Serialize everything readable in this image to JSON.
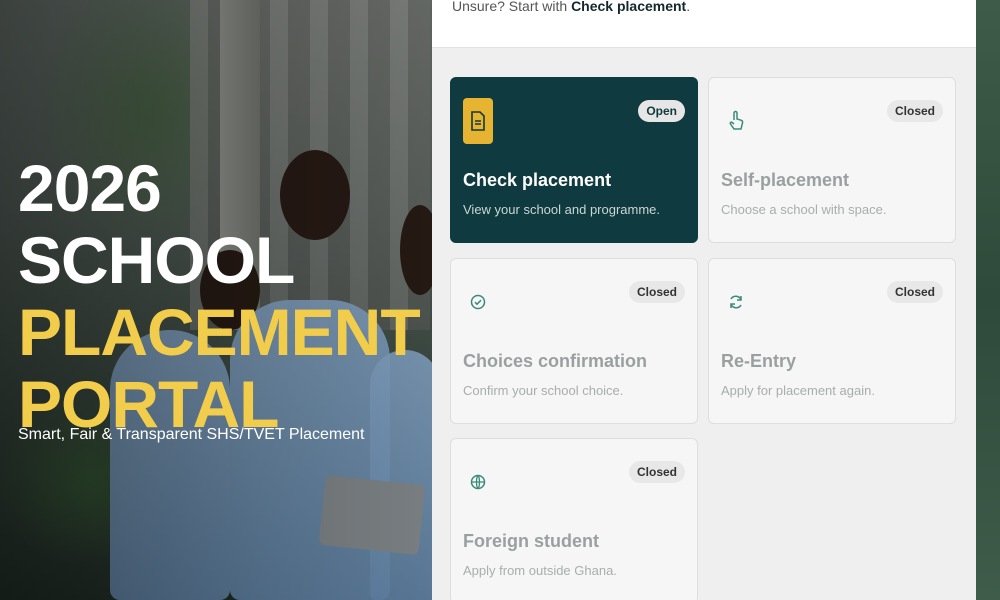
{
  "hero": {
    "title_line1": "2026 SCHOOL",
    "title_line2": "PLACEMENT",
    "title_line3": "PORTAL",
    "subtitle": "Smart, Fair & Transparent SHS/TVET Placement"
  },
  "panel": {
    "hint_prefix": "Unsure? Start with ",
    "hint_link": "Check placement",
    "hint_suffix": "."
  },
  "cards": [
    {
      "title": "Check placement",
      "description": "View your school and programme.",
      "status": "Open",
      "icon": "document-icon",
      "active": true
    },
    {
      "title": "Self-placement",
      "description": "Choose a school with space.",
      "status": "Closed",
      "icon": "hand-pointer-icon",
      "active": false
    },
    {
      "title": "Choices confirmation",
      "description": "Confirm your school choice.",
      "status": "Closed",
      "icon": "check-circle-icon",
      "active": false
    },
    {
      "title": "Re-Entry",
      "description": "Apply for placement again.",
      "status": "Closed",
      "icon": "refresh-icon",
      "active": false
    },
    {
      "title": "Foreign student",
      "description": "Apply from outside Ghana.",
      "status": "Closed",
      "icon": "globe-icon",
      "active": false
    }
  ],
  "colors": {
    "accent_yellow": "#f2cd4b",
    "active_card": "#0f3a3f",
    "icon_yellow": "#e7b431"
  }
}
